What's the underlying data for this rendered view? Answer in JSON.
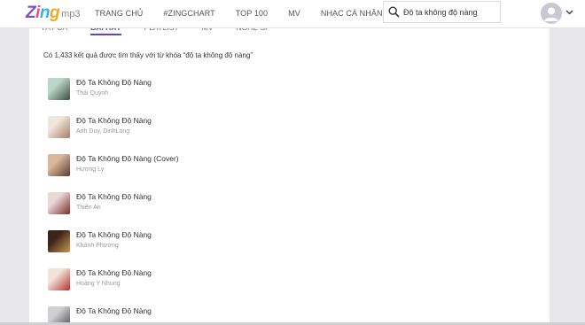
{
  "logo": {
    "letters": [
      {
        "ch": "Z",
        "color": "#7c4dc4"
      },
      {
        "ch": "i",
        "color": "#e94b86"
      },
      {
        "ch": "n",
        "color": "#34b3e4"
      },
      {
        "ch": "g",
        "color": "#f5a623"
      }
    ],
    "suffix": "mp3"
  },
  "nav": [
    {
      "label": "TRANG CHỦ"
    },
    {
      "label": "#ZINGCHART"
    },
    {
      "label": "TOP 100"
    },
    {
      "label": "MV"
    },
    {
      "label": "NHẠC CÁ NHÂN"
    }
  ],
  "search": {
    "value": "Độ ta không độ nàng",
    "icon": "search-icon"
  },
  "user": {
    "icon": "avatar-icon",
    "caret": "chevron-down-icon"
  },
  "tabs": [
    {
      "label": "TẤT CẢ",
      "active": false
    },
    {
      "label": "BÀI HÁT",
      "active": true
    },
    {
      "label": "PLAYLIST",
      "active": false
    },
    {
      "label": "MV",
      "active": false
    },
    {
      "label": "NGHỆ SĨ",
      "active": false
    }
  ],
  "result_text": "Có 1,433 kết quả được tìm thấy với từ khóa “độ ta không độ nàng”",
  "songs": [
    {
      "title": "Độ Ta Không Độ Nàng",
      "artist": "Thái Quỳnh",
      "thumb_colors": [
        "#b9d6c8",
        "#3d4b3f"
      ]
    },
    {
      "title": "Độ Ta Không Độ Nàng",
      "artist": "Anh Duy,  DinhLong",
      "thumb_colors": [
        "#efe6dc",
        "#a47e64"
      ]
    },
    {
      "title": "Độ Ta Không Độ Nàng (Cover)",
      "artist": "Hương Ly",
      "thumb_colors": [
        "#d9b89b",
        "#5a3a2c"
      ]
    },
    {
      "title": "Độ Ta Không Độ Nàng",
      "artist": "Thiên An",
      "thumb_colors": [
        "#e8d8d6",
        "#7a2a2a"
      ]
    },
    {
      "title": "Độ Ta Không Độ Nàng",
      "artist": "Khánh Phương",
      "thumb_colors": [
        "#3b2418",
        "#c99a55"
      ]
    },
    {
      "title": "Độ Ta Không Độ Nàng",
      "artist": "Hoàng Y Nhung",
      "thumb_colors": [
        "#f3e2d8",
        "#b0352f"
      ]
    },
    {
      "title": "Độ Ta Không Độ Nàng",
      "artist": "",
      "thumb_colors": [
        "#d0d0d0",
        "#4a4a4a"
      ]
    }
  ]
}
